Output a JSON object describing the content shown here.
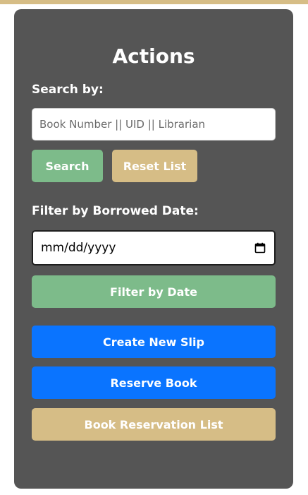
{
  "panel": {
    "title": "Actions"
  },
  "search": {
    "label": "Search by:",
    "value": "",
    "placeholder": "Book Number || UID || Librarian",
    "search_button": "Search",
    "reset_button": "Reset List"
  },
  "filter": {
    "label": "Filter by Borrowed Date:",
    "date_value": "mm/dd/yyyy",
    "calendar_icon": "calendar-icon",
    "filter_button": "Filter by Date"
  },
  "actions": {
    "create_slip": "Create New Slip",
    "reserve_book": "Reserve Book",
    "reservation_list": "Book Reservation List"
  },
  "colors": {
    "accent_gold": "#d6bd86",
    "panel_bg": "#555555",
    "green": "#7dbb8a",
    "blue": "#0a74ff"
  }
}
